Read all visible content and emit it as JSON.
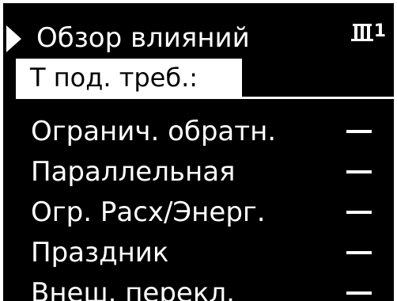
{
  "header": {
    "title": "Обзор влияний",
    "circuit_number": "1",
    "circuit_icon": "heating-circuit-icon"
  },
  "subheader": {
    "label": "Т под. треб.:"
  },
  "params": [
    {
      "label": "Огранич. обратн.",
      "value": "—"
    },
    {
      "label": "Параллельная",
      "value": "—"
    },
    {
      "label": "Огр. Расх/Энерг.",
      "value": "—"
    },
    {
      "label": "Праздник",
      "value": "—"
    },
    {
      "label": "Внеш. перекл.",
      "value": "—"
    }
  ],
  "colors": {
    "background": "#000000",
    "foreground": "#ffffff",
    "frame": "#ffffff"
  }
}
